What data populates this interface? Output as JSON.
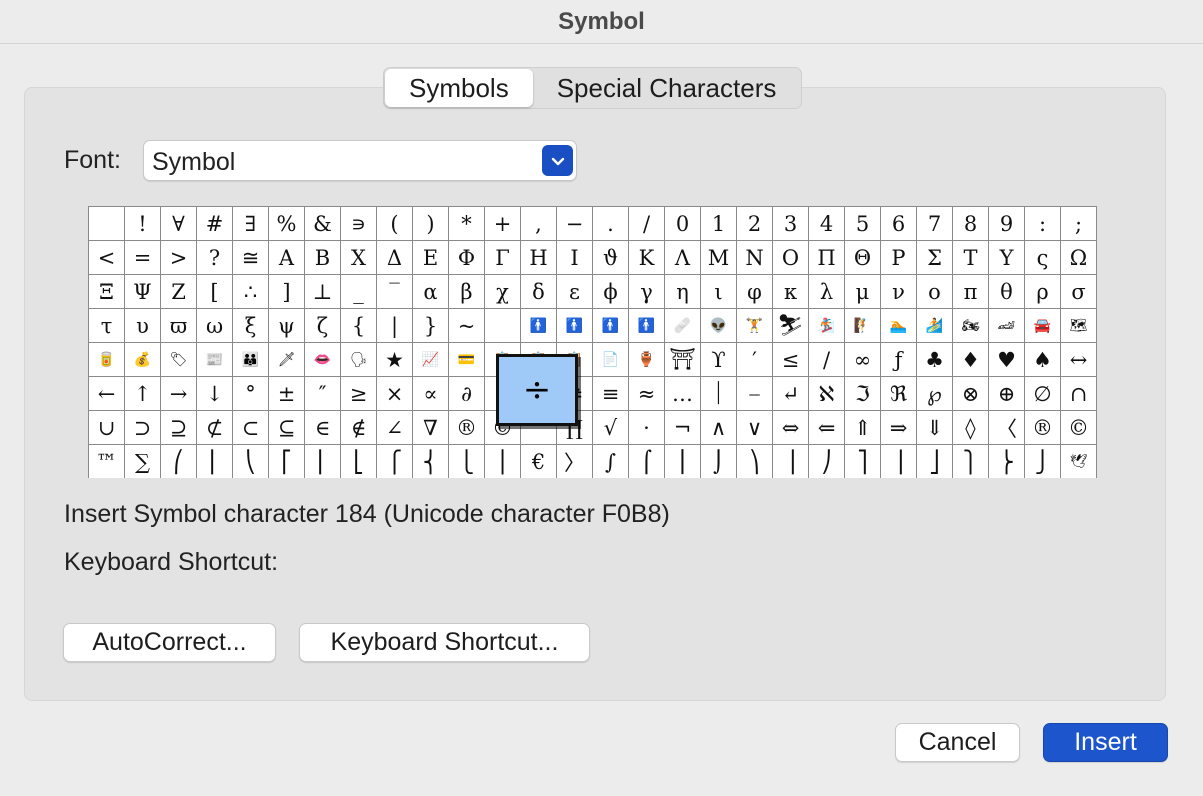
{
  "window": {
    "title": "Symbol"
  },
  "tabs": [
    {
      "label": "Symbols",
      "selected": true
    },
    {
      "label": "Special Characters",
      "selected": false
    }
  ],
  "font": {
    "label": "Font:",
    "value": "Symbol"
  },
  "grid": {
    "rows": [
      [
        " ",
        "!",
        "∀",
        "#",
        "∃",
        "%",
        "&",
        "∍",
        "(",
        ")",
        "*",
        "+",
        ",",
        "−",
        ".",
        "/",
        "0",
        "1",
        "2",
        "3",
        "4",
        "5",
        "6",
        "7",
        "8",
        "9",
        ":",
        ";"
      ],
      [
        "<",
        "=",
        ">",
        "?",
        "≅",
        "Α",
        "Β",
        "Χ",
        "Δ",
        "Ε",
        "Φ",
        "Γ",
        "Η",
        "Ι",
        "ϑ",
        "Κ",
        "Λ",
        "Μ",
        "Ν",
        "Ο",
        "Π",
        "Θ",
        "Ρ",
        "Σ",
        "Τ",
        "Υ",
        "ς",
        "Ω"
      ],
      [
        "Ξ",
        "Ψ",
        "Ζ",
        "[",
        "∴",
        "]",
        "⊥",
        "_",
        "‾",
        "α",
        "β",
        "χ",
        "δ",
        "ε",
        "ϕ",
        "γ",
        "η",
        "ι",
        "φ",
        "κ",
        "λ",
        "μ",
        "ν",
        "ο",
        "π",
        "θ",
        "ρ",
        "σ"
      ],
      [
        "τ",
        "υ",
        "ϖ",
        "ω",
        "ξ",
        "ψ",
        "ζ",
        "{",
        "|",
        "}",
        "~",
        " ",
        "🚹",
        "🚹",
        "🚹",
        "🚹",
        "🩹",
        "👽",
        "🏋",
        "⛷",
        "🏂",
        "🧗",
        "🏊",
        "🏄",
        "🏍",
        "🏎",
        "🚘",
        "🗺"
      ],
      [
        "🥫",
        "💰",
        "🏷",
        "📰",
        "👪",
        "🗡",
        "👄",
        "🗣",
        "★",
        "📈",
        "💳",
        "📋",
        "📋",
        "📋",
        "📄",
        "🏺",
        "⛩",
        "ϒ",
        "′",
        "≤",
        "/",
        "∞",
        "ƒ",
        "♣",
        "♦",
        "♥",
        "♠",
        "↔"
      ],
      [
        "←",
        "↑",
        "→",
        "↓",
        "°",
        "±",
        "″",
        "≥",
        "×",
        "∝",
        "∂",
        "•",
        "÷",
        "≠",
        "≡",
        "≈",
        "…",
        "⏐",
        "⎯",
        "↵",
        "ℵ",
        "ℑ",
        "ℜ",
        "℘",
        "⊗",
        "⊕",
        "∅",
        "∩"
      ],
      [
        "∪",
        "⊃",
        "⊇",
        "⊄",
        "⊂",
        "⊆",
        "∈",
        "∉",
        "∠",
        "∇",
        "®",
        "©",
        "™",
        "∏",
        "√",
        "⋅",
        "¬",
        "∧",
        "∨",
        "⇔",
        "⇐",
        "⇑",
        "⇒",
        "⇓",
        "◊",
        "〈",
        "®",
        "©"
      ],
      [
        "™",
        "∑",
        "⎛",
        "⎜",
        "⎝",
        "⎡",
        "⎢",
        "⎣",
        "⎧",
        "⎨",
        "⎩",
        "⎪",
        "€",
        "〉",
        "∫",
        "⌠",
        "⎮",
        "⌡",
        "⎞",
        "⎟",
        "⎠",
        "⎤",
        "⎥",
        "⎦",
        "⎫",
        "⎬",
        "⎭",
        "🕊"
      ]
    ],
    "magnified": "÷"
  },
  "status": {
    "insert_text": "Insert Symbol character 184  (Unicode character F0B8)",
    "shortcut_label": "Keyboard Shortcut:"
  },
  "buttons": {
    "autocorrect": "AutoCorrect...",
    "keyboard_shortcut": "Keyboard Shortcut...",
    "cancel": "Cancel",
    "insert": "Insert"
  },
  "colors": {
    "accent": "#1c55cc",
    "selected_cell": "#9fcaf7",
    "background": "#ececec"
  },
  "icons": {
    "font_dropdown": "chevron-down-icon"
  }
}
